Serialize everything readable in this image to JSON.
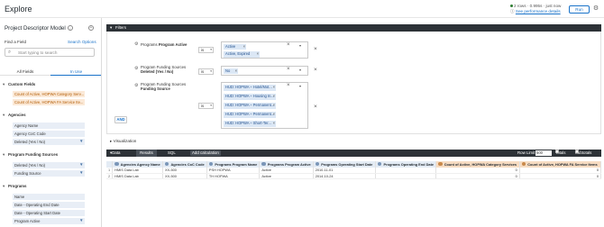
{
  "app": {
    "title": "Explore",
    "rows_info": "2 rows · 0.995s · just now",
    "perf_link": "See performance details",
    "run_label": "Run"
  },
  "sidebar": {
    "model_title": "Project Descriptor Model",
    "find_label": "Find a Field",
    "search_options": "Search Options",
    "search_placeholder": "Start typing to search",
    "tabs": [
      "All Fields",
      "In Use"
    ],
    "groups": [
      {
        "name": "Custom Fields",
        "fields": [
          "Count of Active, HOPWA Category Serv...",
          "Count of Active, HOPWA FA Service Ite..."
        ]
      },
      {
        "name": "Agencies",
        "fields": [
          "Agency Name",
          "Agency CoC Code",
          "Deleted (Yes / No)"
        ]
      },
      {
        "name": "Program Funding Sources",
        "fields": [
          "Deleted (Yes / No)",
          "Funding Source"
        ]
      },
      {
        "name": "Programs",
        "fields": [
          "Name",
          "Date - Operating End Date",
          "Date - Operating Start Date",
          "Program Active"
        ]
      }
    ]
  },
  "filters": {
    "title": "Filters",
    "rows": [
      {
        "group": "Programs",
        "field": "Program Active",
        "op": "is",
        "chips": [
          "Active",
          "Active, Expired"
        ]
      },
      {
        "group": "Program Funding Sources",
        "field": "Deleted (Yes / No)",
        "op": "is",
        "chips": [
          "No"
        ]
      },
      {
        "group": "Program Funding Sources",
        "field": "Funding Source",
        "op": "is",
        "chips": [
          "HUD: HOPWA – Hotel/Mot...",
          "HUD: HOPWA – Housing In...",
          "HUD: HOPWA – Permanent...",
          "HUD: HOPWA – Permanent...",
          "HUD: HOPWA – Short-Ter..."
        ]
      }
    ],
    "and_label": "AND"
  },
  "visualization": {
    "title": "Visualization"
  },
  "data": {
    "title": "Data",
    "tabs": [
      "Results",
      "SQL"
    ],
    "add_calc": "Add calculation",
    "row_limit_label": "Row Limit",
    "row_limit_value": "500",
    "totals_label": "Totals",
    "subtotals_label": "Subtotals",
    "columns": [
      "Agencies Agency Name",
      "Agencies CoC Code",
      "Programs Program Name",
      "Programs Program Active",
      "Programs Operating Start Date",
      "Programs Operating End Date",
      "Count of Active, HOPWA Category Services",
      "Count of Active, HOPWA FA Service Items"
    ],
    "rows": [
      {
        "n": "1",
        "cells": [
          "HMIS Data Lab",
          "XX-500",
          "PSH HOPWA",
          "Active",
          "2010-11-01",
          "",
          "0",
          "0"
        ]
      },
      {
        "n": "2",
        "cells": [
          "HMIS Data Lab",
          "XX-500",
          "TH HOPWA",
          "Active",
          "2014-10-24",
          "",
          "0",
          "0"
        ]
      }
    ]
  },
  "colors": {
    "accent": "#1a73c9",
    "dark_bar": "#2d3237",
    "custom_field": "#f7dcc2"
  }
}
